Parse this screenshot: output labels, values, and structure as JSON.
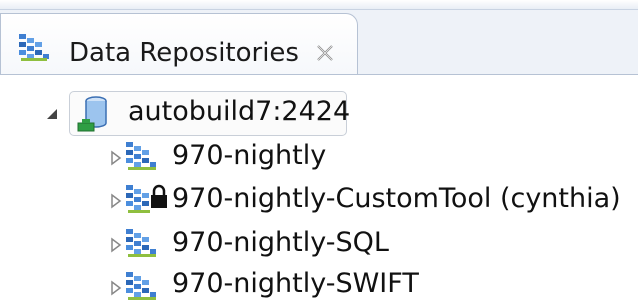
{
  "view": {
    "title": "Data Repositories",
    "tab_icon": "repository-icon",
    "close_icon": "close-icon"
  },
  "tree": {
    "root": {
      "label": "autobuild7:2424",
      "icon": "database-server-icon",
      "expanded": true
    },
    "children": [
      {
        "label": "970-nightly",
        "icon": "repository-icon",
        "locked": false,
        "expanded": false
      },
      {
        "label": "970-nightly-CustomTool (cynthia)",
        "icon": "repository-locked-icon",
        "locked": true,
        "expanded": false
      },
      {
        "label": "970-nightly-SQL",
        "icon": "repository-icon",
        "locked": false,
        "expanded": false
      },
      {
        "label": "970-nightly-SWIFT",
        "icon": "repository-icon",
        "locked": false,
        "expanded": false
      }
    ]
  }
}
